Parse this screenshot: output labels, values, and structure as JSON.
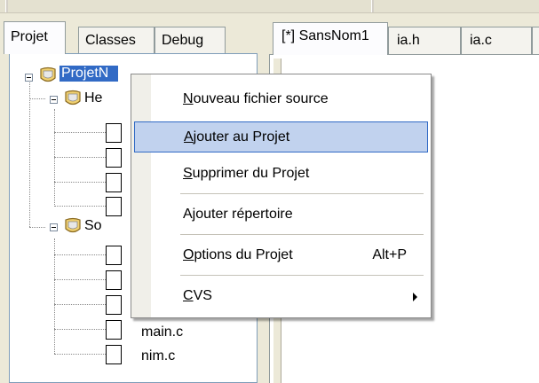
{
  "left_tabs": [
    "Projet",
    "Classes",
    "Debug"
  ],
  "editor_tabs": [
    "[*] SansNom1",
    "ia.h",
    "ia.c"
  ],
  "tree": {
    "root": "ProjetNim",
    "root_visible": "ProjetN",
    "groups": [
      {
        "label_visible": "He",
        "files": [
          "",
          "",
          "",
          ""
        ]
      },
      {
        "label_visible": "So",
        "files": [
          "",
          "",
          "",
          "main.c",
          "nim.c"
        ]
      }
    ]
  },
  "context_menu": {
    "items": [
      {
        "underline": "N",
        "rest": "ouveau fichier source",
        "shortcut": "",
        "submenu": false
      },
      {
        "underline": "A",
        "rest": "jouter au Projet",
        "shortcut": "",
        "submenu": false,
        "highlighted": true
      },
      {
        "underline": "S",
        "rest": "upprimer du Projet",
        "shortcut": "",
        "submenu": false
      },
      {
        "underline": "",
        "rest": "Ajouter répertoire",
        "shortcut": "",
        "submenu": false
      },
      {
        "underline": "O",
        "rest": "ptions du Projet",
        "shortcut": "Alt+P",
        "submenu": false
      },
      {
        "underline": "C",
        "rest": "VS",
        "shortcut": "",
        "submenu": true
      }
    ]
  },
  "colors": {
    "selection": "#316ac5",
    "menu_highlight": "#c1d2ee",
    "window_bg": "#ece9d8"
  }
}
